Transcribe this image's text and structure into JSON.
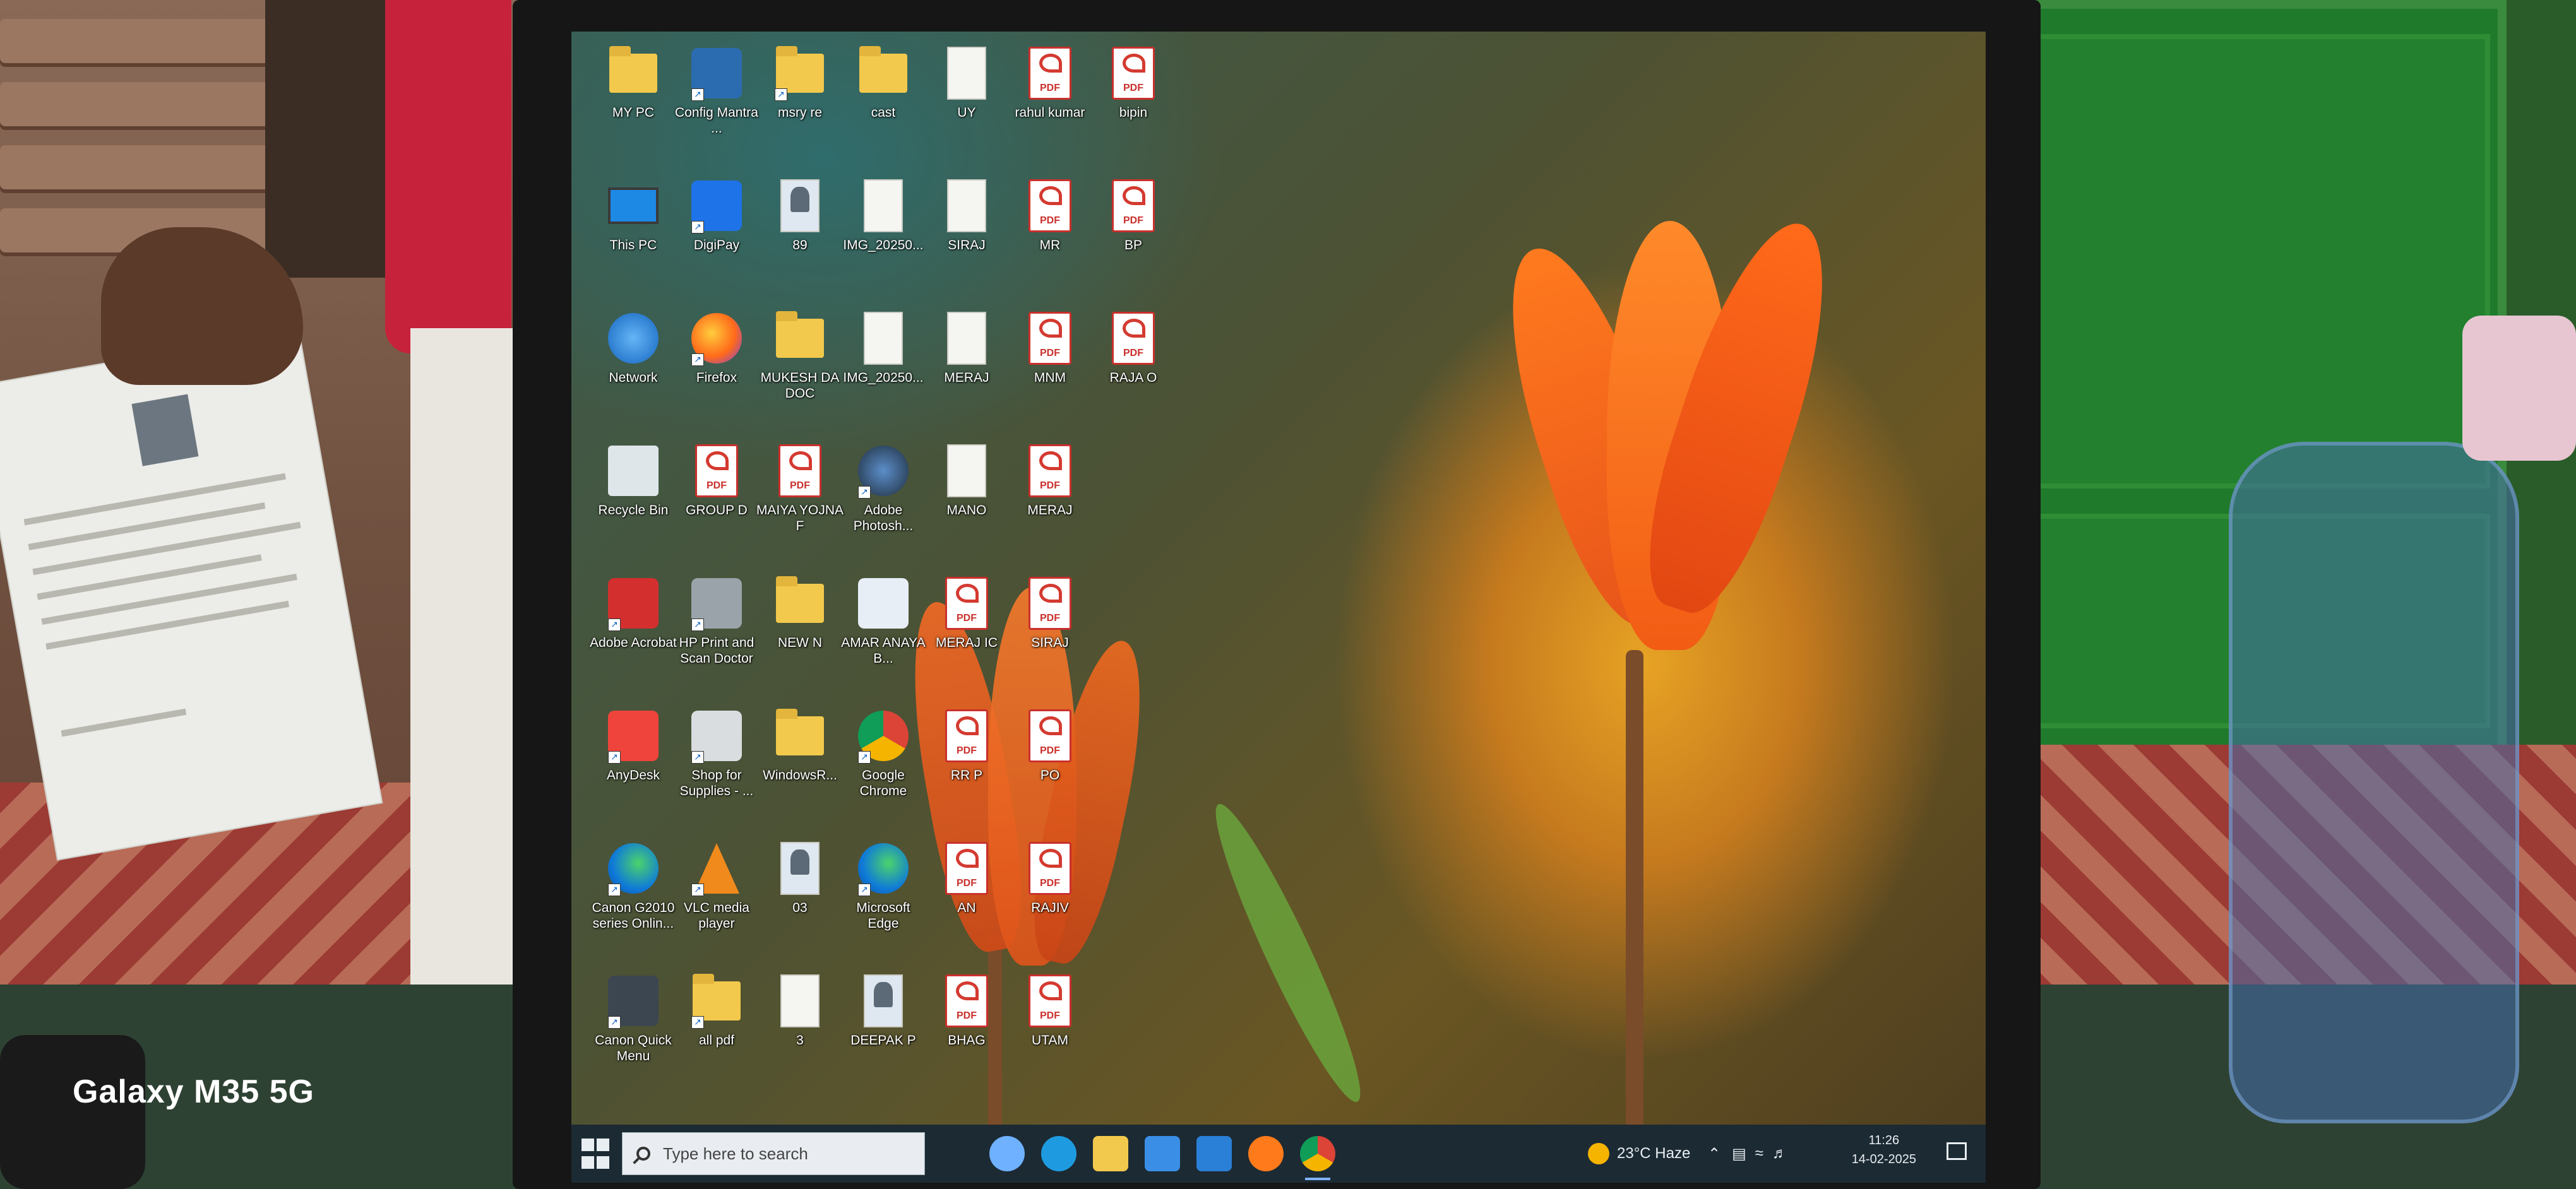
{
  "watermark": "Galaxy M35 5G",
  "desktop": {
    "icons": [
      {
        "label": "MY PC",
        "glyph": "folder",
        "col": 0,
        "row": 0
      },
      {
        "label": "Config Mantra ...",
        "glyph": "app-blue",
        "col": 1,
        "row": 0,
        "shortcut": true
      },
      {
        "label": "msry re",
        "glyph": "folder",
        "col": 2,
        "row": 0,
        "shortcut": true
      },
      {
        "label": "cast",
        "glyph": "folder",
        "col": 3,
        "row": 0
      },
      {
        "label": "UY",
        "glyph": "doc",
        "col": 4,
        "row": 0
      },
      {
        "label": "rahul kumar",
        "glyph": "pdf",
        "col": 5,
        "row": 0
      },
      {
        "label": "bipin",
        "glyph": "pdf",
        "col": 6,
        "row": 0
      },
      {
        "label": "This PC",
        "glyph": "pc",
        "col": 0,
        "row": 1
      },
      {
        "label": "DigiPay",
        "glyph": "digipay",
        "col": 1,
        "row": 1,
        "shortcut": true
      },
      {
        "label": "89",
        "glyph": "photo",
        "col": 2,
        "row": 1
      },
      {
        "label": "IMG_20250...",
        "glyph": "doc",
        "col": 3,
        "row": 1
      },
      {
        "label": "SIRAJ",
        "glyph": "doc",
        "col": 4,
        "row": 1
      },
      {
        "label": "MR",
        "glyph": "pdf",
        "col": 5,
        "row": 1
      },
      {
        "label": "BP",
        "glyph": "pdf",
        "col": 6,
        "row": 1
      },
      {
        "label": "Network",
        "glyph": "network",
        "col": 0,
        "row": 2
      },
      {
        "label": "Firefox",
        "glyph": "firefox",
        "col": 1,
        "row": 2,
        "shortcut": true
      },
      {
        "label": "MUKESH DA DOC",
        "glyph": "folder",
        "col": 2,
        "row": 2
      },
      {
        "label": "IMG_20250...",
        "glyph": "doc",
        "col": 3,
        "row": 2
      },
      {
        "label": "MERAJ",
        "glyph": "doc",
        "col": 4,
        "row": 2
      },
      {
        "label": "MNM",
        "glyph": "pdf",
        "col": 5,
        "row": 2
      },
      {
        "label": "RAJA O",
        "glyph": "pdf",
        "col": 6,
        "row": 2
      },
      {
        "label": "Recycle Bin",
        "glyph": "recycle",
        "col": 0,
        "row": 3
      },
      {
        "label": "GROUP D",
        "glyph": "pdf",
        "col": 1,
        "row": 3
      },
      {
        "label": "MAIYA YOJNA F",
        "glyph": "pdf",
        "col": 2,
        "row": 3
      },
      {
        "label": "Adobe Photosh...",
        "glyph": "photoshop",
        "col": 3,
        "row": 3,
        "shortcut": true
      },
      {
        "label": "MANO",
        "glyph": "doc",
        "col": 4,
        "row": 3
      },
      {
        "label": "MERAJ",
        "glyph": "pdf",
        "col": 5,
        "row": 3
      },
      {
        "label": "Adobe Acrobat",
        "glyph": "acrobat",
        "col": 0,
        "row": 4,
        "shortcut": true
      },
      {
        "label": "HP Print and Scan Doctor",
        "glyph": "hp",
        "col": 1,
        "row": 4,
        "shortcut": true
      },
      {
        "label": "NEW N",
        "glyph": "folder",
        "col": 2,
        "row": 4
      },
      {
        "label": "AMAR ANAYA B...",
        "glyph": "word",
        "col": 3,
        "row": 4
      },
      {
        "label": "MERAJ IC",
        "glyph": "pdf",
        "col": 4,
        "row": 4
      },
      {
        "label": "SIRAJ",
        "glyph": "pdf",
        "col": 5,
        "row": 4
      },
      {
        "label": "AnyDesk",
        "glyph": "anydesk",
        "col": 0,
        "row": 5,
        "shortcut": true
      },
      {
        "label": "Shop for Supplies - ...",
        "glyph": "printer",
        "col": 1,
        "row": 5,
        "shortcut": true
      },
      {
        "label": "WindowsR...",
        "glyph": "folder",
        "col": 2,
        "row": 5
      },
      {
        "label": "Google Chrome",
        "glyph": "chrome",
        "col": 3,
        "row": 5,
        "shortcut": true
      },
      {
        "label": "RR P",
        "glyph": "pdf",
        "col": 4,
        "row": 5
      },
      {
        "label": "PO",
        "glyph": "pdf",
        "col": 5,
        "row": 5
      },
      {
        "label": "Canon G2010 series Onlin...",
        "glyph": "edge",
        "col": 0,
        "row": 6,
        "shortcut": true
      },
      {
        "label": "VLC media player",
        "glyph": "vlc",
        "col": 1,
        "row": 6,
        "shortcut": true
      },
      {
        "label": "03",
        "glyph": "photo",
        "col": 2,
        "row": 6
      },
      {
        "label": "Microsoft Edge",
        "glyph": "edge",
        "col": 3,
        "row": 6,
        "shortcut": true
      },
      {
        "label": "AN",
        "glyph": "pdf",
        "col": 4,
        "row": 6
      },
      {
        "label": "RAJIV",
        "glyph": "pdf",
        "col": 5,
        "row": 6
      },
      {
        "label": "Canon Quick Menu",
        "glyph": "canon",
        "col": 0,
        "row": 7,
        "shortcut": true
      },
      {
        "label": "all pdf",
        "glyph": "folder",
        "col": 1,
        "row": 7,
        "shortcut": true
      },
      {
        "label": "3",
        "glyph": "doc",
        "col": 2,
        "row": 7
      },
      {
        "label": "DEEPAK P",
        "glyph": "photo",
        "col": 3,
        "row": 7
      },
      {
        "label": "BHAG",
        "glyph": "pdf",
        "col": 4,
        "row": 7
      },
      {
        "label": "UTAM",
        "glyph": "pdf",
        "col": 5,
        "row": 7
      }
    ]
  },
  "taskbar": {
    "search_placeholder": "Type here to search",
    "apps": [
      {
        "name": "copilot-icon",
        "color": "#6fb1ff"
      },
      {
        "name": "edge-icon",
        "color": "#1e9be0"
      },
      {
        "name": "file-explorer-icon",
        "color": "#f2c94c"
      },
      {
        "name": "store-icon",
        "color": "#3a8ee6"
      },
      {
        "name": "mail-icon",
        "color": "#2a7fd6"
      },
      {
        "name": "firefox-icon",
        "color": "#ff7a1a"
      },
      {
        "name": "chrome-icon",
        "color": "#e53935"
      }
    ],
    "weather": "23°C Haze",
    "time": "11:26",
    "date": "14-02-2025"
  },
  "pdf_badge": "PDF"
}
